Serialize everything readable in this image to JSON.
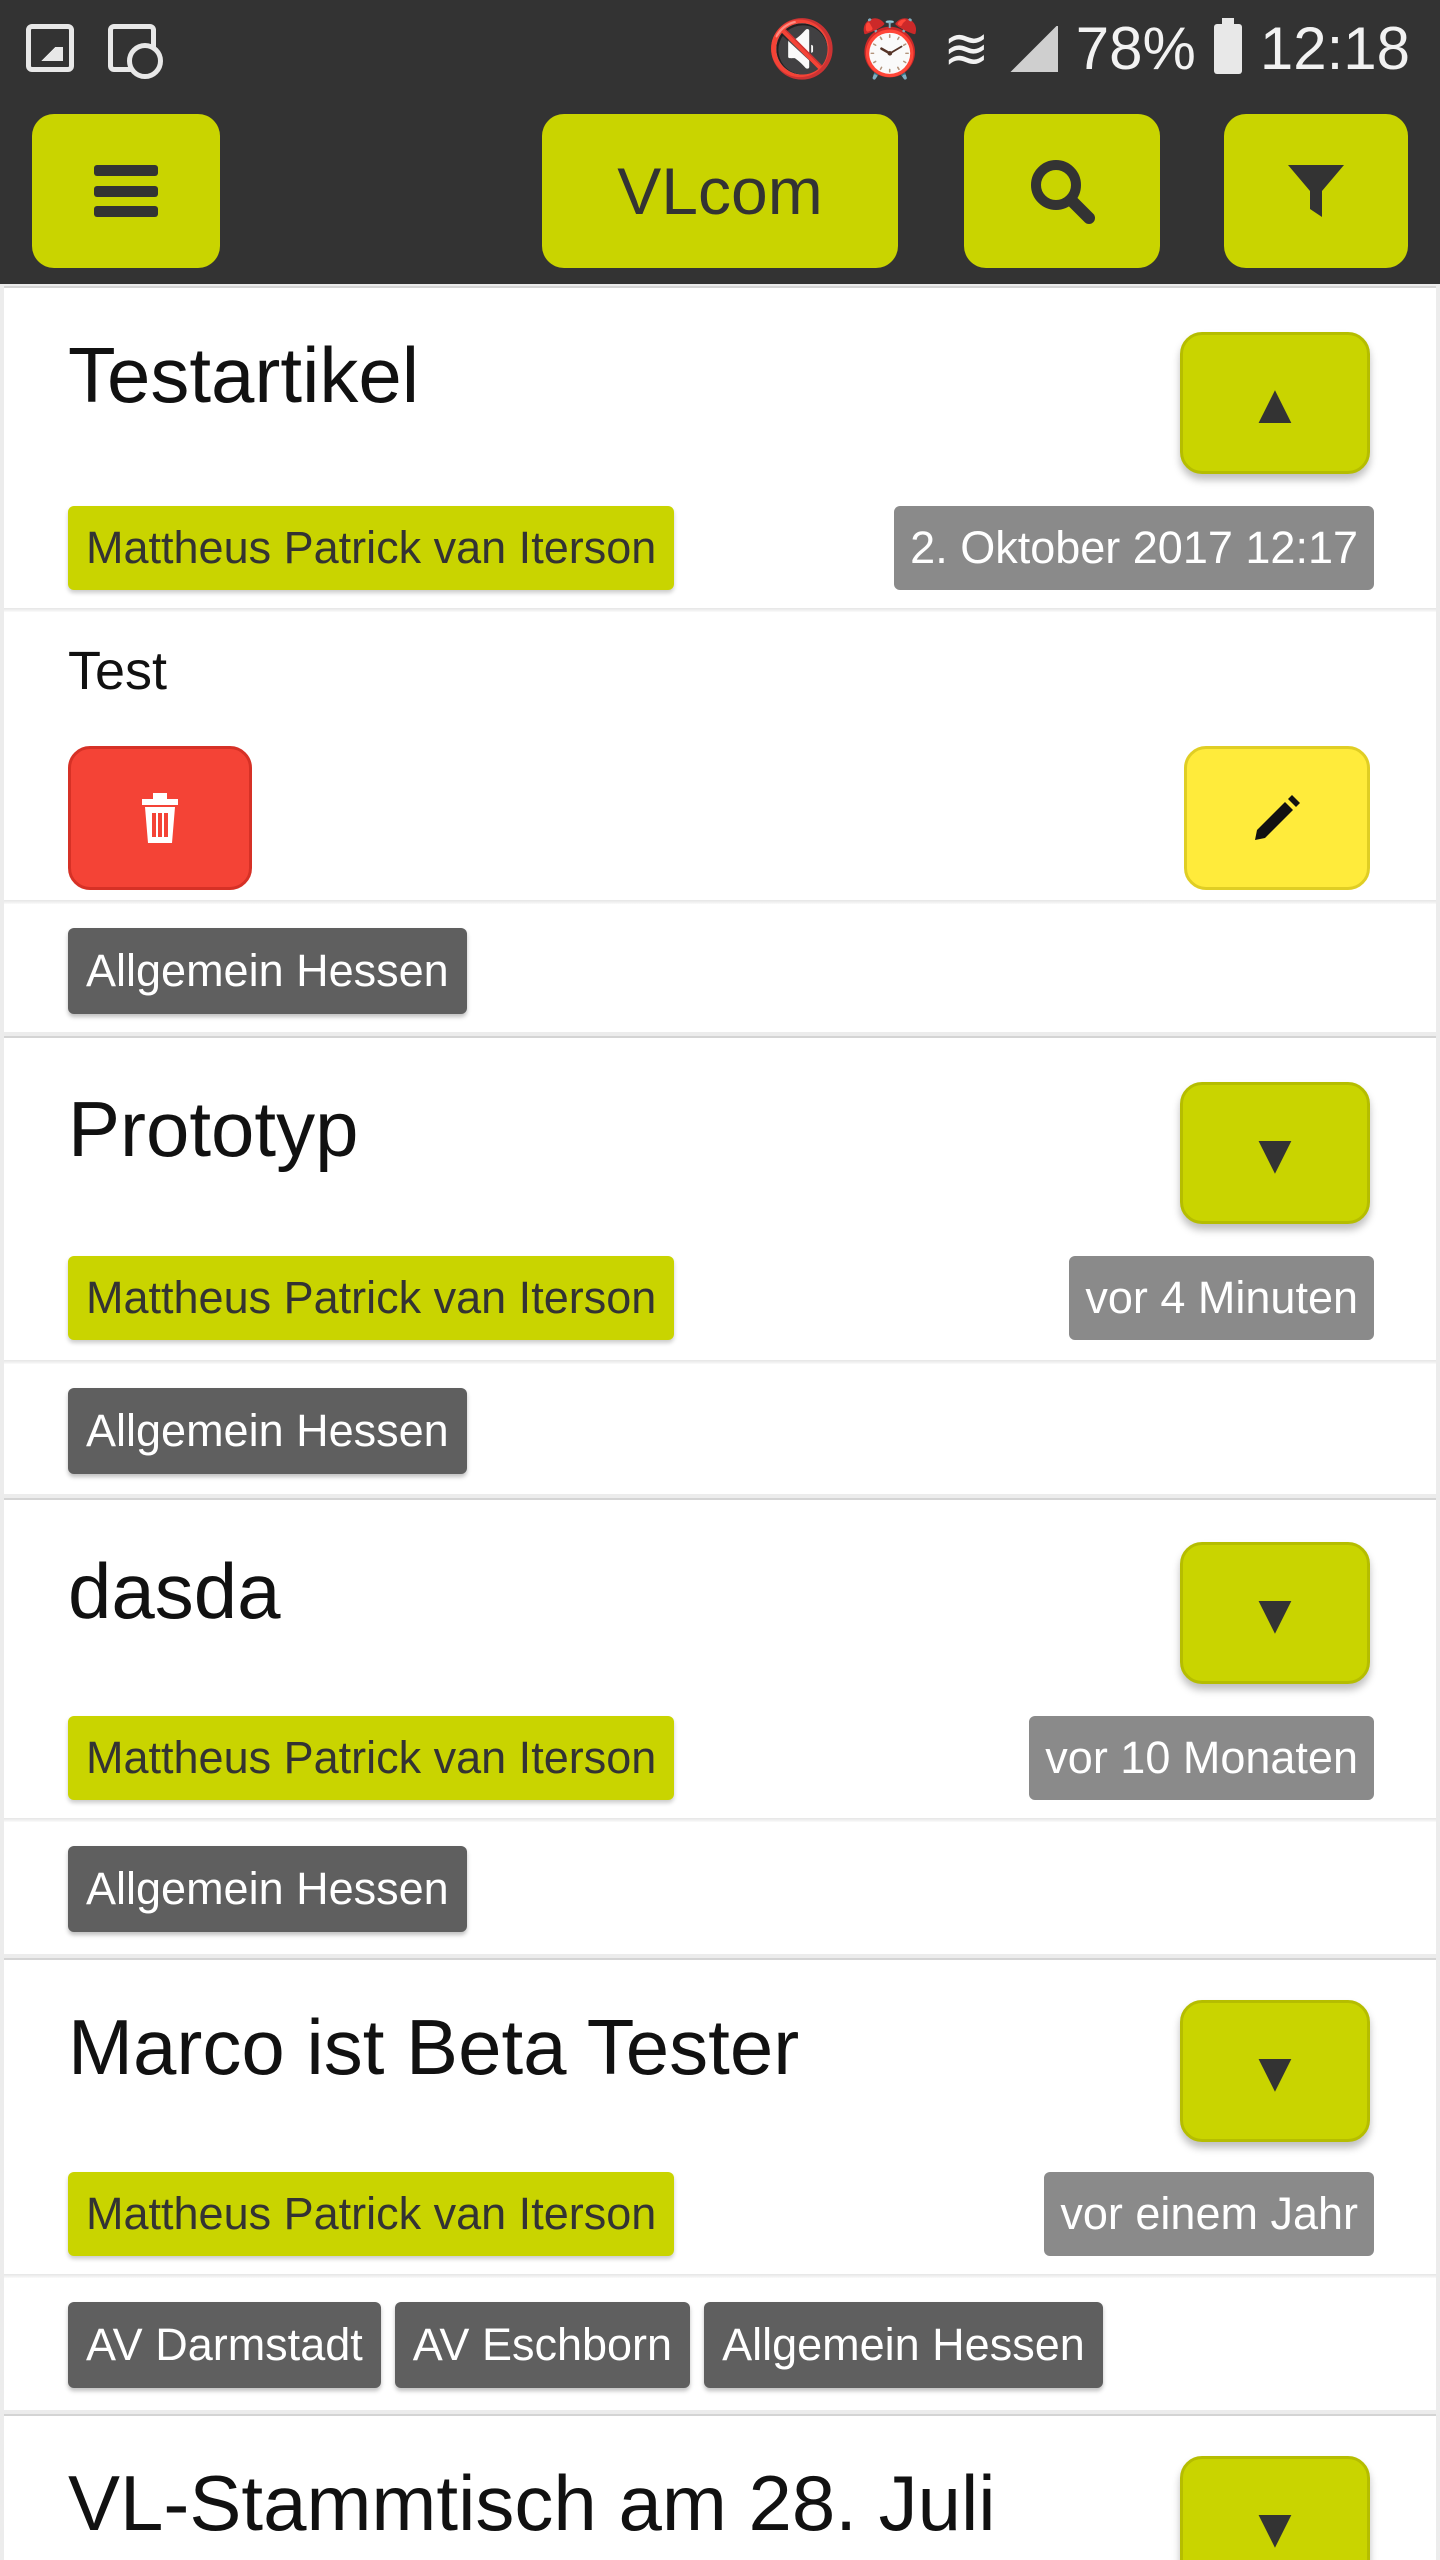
{
  "status_bar": {
    "battery": "78%",
    "time": "12:18",
    "icons": [
      "image-icon",
      "clock-icon",
      "mute-icon",
      "alarm-icon",
      "wifi-icon",
      "signal-icon",
      "battery-icon"
    ]
  },
  "app_bar": {
    "brand": "VLcom",
    "icons": [
      "menu-icon",
      "search-icon",
      "filter-icon"
    ]
  },
  "colors": {
    "accent": "#c9d400",
    "bar": "#333333",
    "delete": "#f44336",
    "edit": "#ffeb3b",
    "tag": "#5f5f5f",
    "date_badge": "#8a8a8a"
  },
  "articles": [
    {
      "title": "Testartikel",
      "author": "Mattheus Patrick van Iterson",
      "date": "2. Oktober 2017 12:17",
      "expanded": true,
      "toggle": "▲",
      "body": "Test",
      "tags": [
        "Allgemein Hessen"
      ]
    },
    {
      "title": "Prototyp",
      "author": "Mattheus Patrick van Iterson",
      "date": "vor 4 Minuten",
      "expanded": false,
      "toggle": "▼",
      "tags": [
        "Allgemein Hessen"
      ]
    },
    {
      "title": "dasda",
      "author": "Mattheus Patrick van Iterson",
      "date": "vor 10 Monaten",
      "expanded": false,
      "toggle": "▼",
      "tags": [
        "Allgemein Hessen"
      ]
    },
    {
      "title": "Marco ist Beta Tester",
      "author": "Mattheus Patrick van Iterson",
      "date": "vor einem Jahr",
      "expanded": false,
      "toggle": "▼",
      "tags": [
        "AV Darmstadt",
        "AV Eschborn",
        "Allgemein Hessen"
      ]
    },
    {
      "title": "VL-Stammtisch am 28. Juli",
      "expanded": false,
      "toggle": "▼"
    }
  ]
}
